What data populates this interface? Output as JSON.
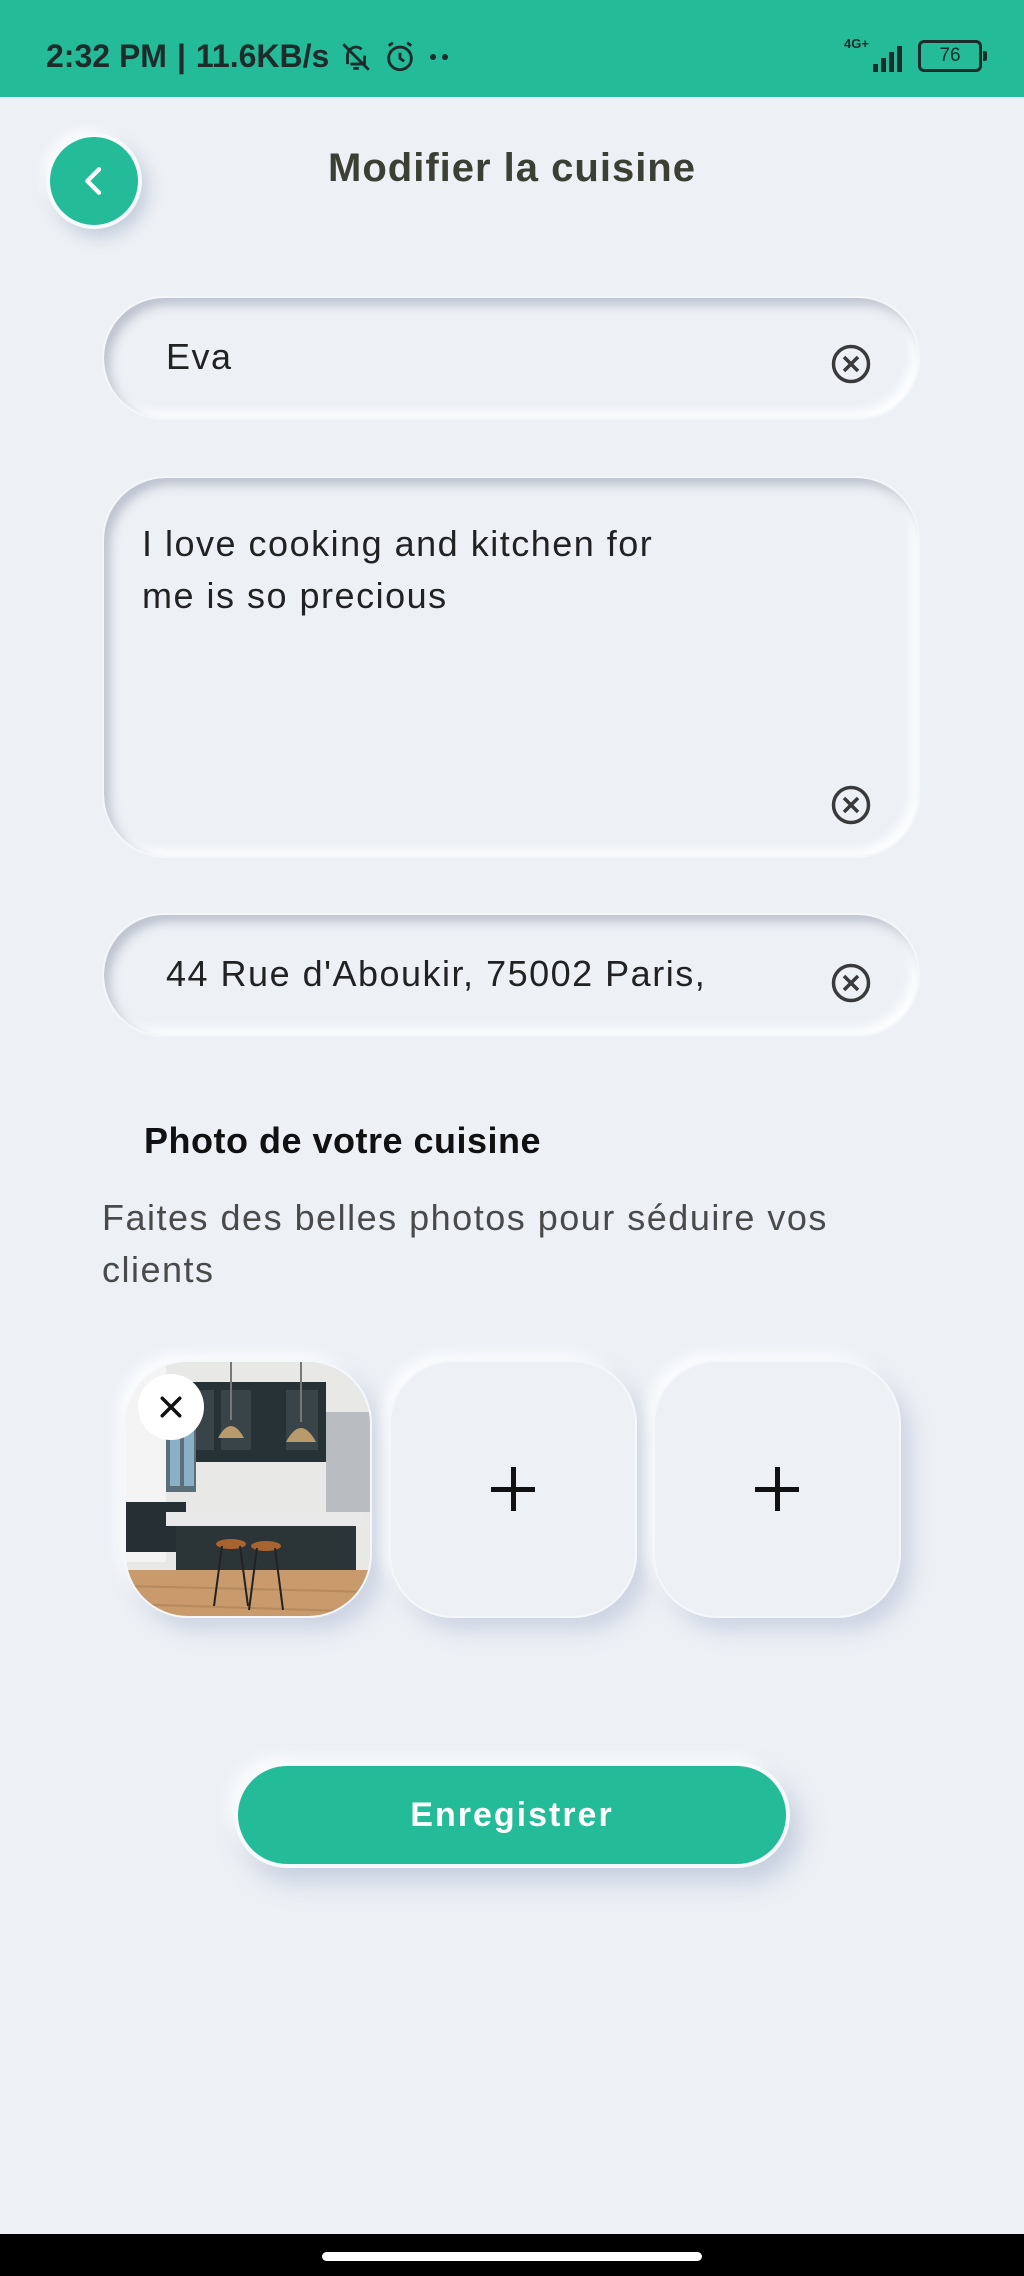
{
  "status_bar": {
    "time": "2:32 PM",
    "speed": "11.6KB/s",
    "network": "4G+",
    "battery": "76",
    "icons": [
      "muted-bell-icon",
      "alarm-icon",
      "more-dots-icon",
      "signal-icon",
      "battery-icon"
    ]
  },
  "header": {
    "title": "Modifier la cuisine",
    "back_icon": "chevron-left-icon"
  },
  "form": {
    "name": "Eva",
    "description": "I love cooking and kitchen for\nme is so precious",
    "address": "44 Rue d'Aboukir, 75002 Paris,"
  },
  "photos": {
    "title": "Photo de votre cuisine",
    "hint": "Faites des belles photos pour séduire vos clients",
    "slots": [
      {
        "state": "filled",
        "icon": "kitchen-photo"
      },
      {
        "state": "empty",
        "icon": "plus-icon"
      },
      {
        "state": "empty",
        "icon": "plus-icon"
      }
    ]
  },
  "actions": {
    "save_label": "Enregistrer"
  },
  "colors": {
    "accent": "#24bb99",
    "background": "#edf1f6"
  }
}
